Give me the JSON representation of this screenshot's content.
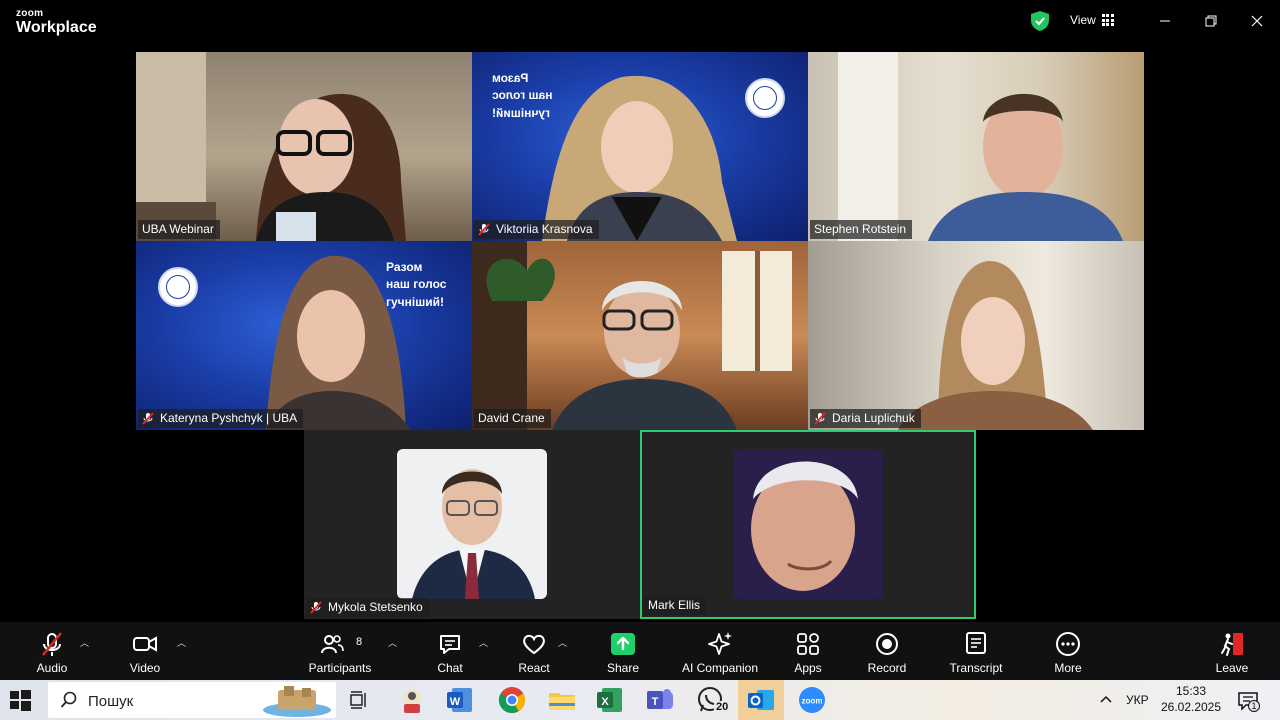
{
  "app": {
    "brand_top": "zoom",
    "brand_bottom": "Workplace"
  },
  "titlebar": {
    "view_label": "View"
  },
  "participants": [
    {
      "name": "UBA Webinar",
      "muted": false
    },
    {
      "name": "Viktoriia Krasnova",
      "muted": true
    },
    {
      "name": "Stephen Rotstein",
      "muted": false
    },
    {
      "name": "Kateryna Pyshchyk | UBA",
      "muted": true
    },
    {
      "name": "David Crane",
      "muted": false
    },
    {
      "name": "Daria Luplichuk",
      "muted": true
    },
    {
      "name": "Mykola Stetsenko",
      "muted": true
    },
    {
      "name": "Mark Ellis",
      "muted": false
    }
  ],
  "backgrounds": {
    "slogan_mirrored": [
      "Разом",
      "наш голос",
      "гучніший!"
    ],
    "slogan": [
      "Разом",
      "наш голос",
      "гучніший!"
    ]
  },
  "toolbar": {
    "audio": "Audio",
    "video": "Video",
    "participants": "Participants",
    "participants_count": "8",
    "chat": "Chat",
    "react": "React",
    "share": "Share",
    "ai_companion": "AI Companion",
    "apps": "Apps",
    "record": "Record",
    "transcript": "Transcript",
    "more": "More",
    "leave": "Leave"
  },
  "taskbar": {
    "search_placeholder": "Пошук",
    "whatsapp_badge": "20",
    "language": "УКР",
    "time": "15:33",
    "date": "26.02.2025",
    "notification_badge": "1"
  },
  "colors": {
    "accent_green": "#2ecc71",
    "share_green": "#1fcf6b",
    "mute_red": "#e02828",
    "leave_red": "#e02828"
  }
}
